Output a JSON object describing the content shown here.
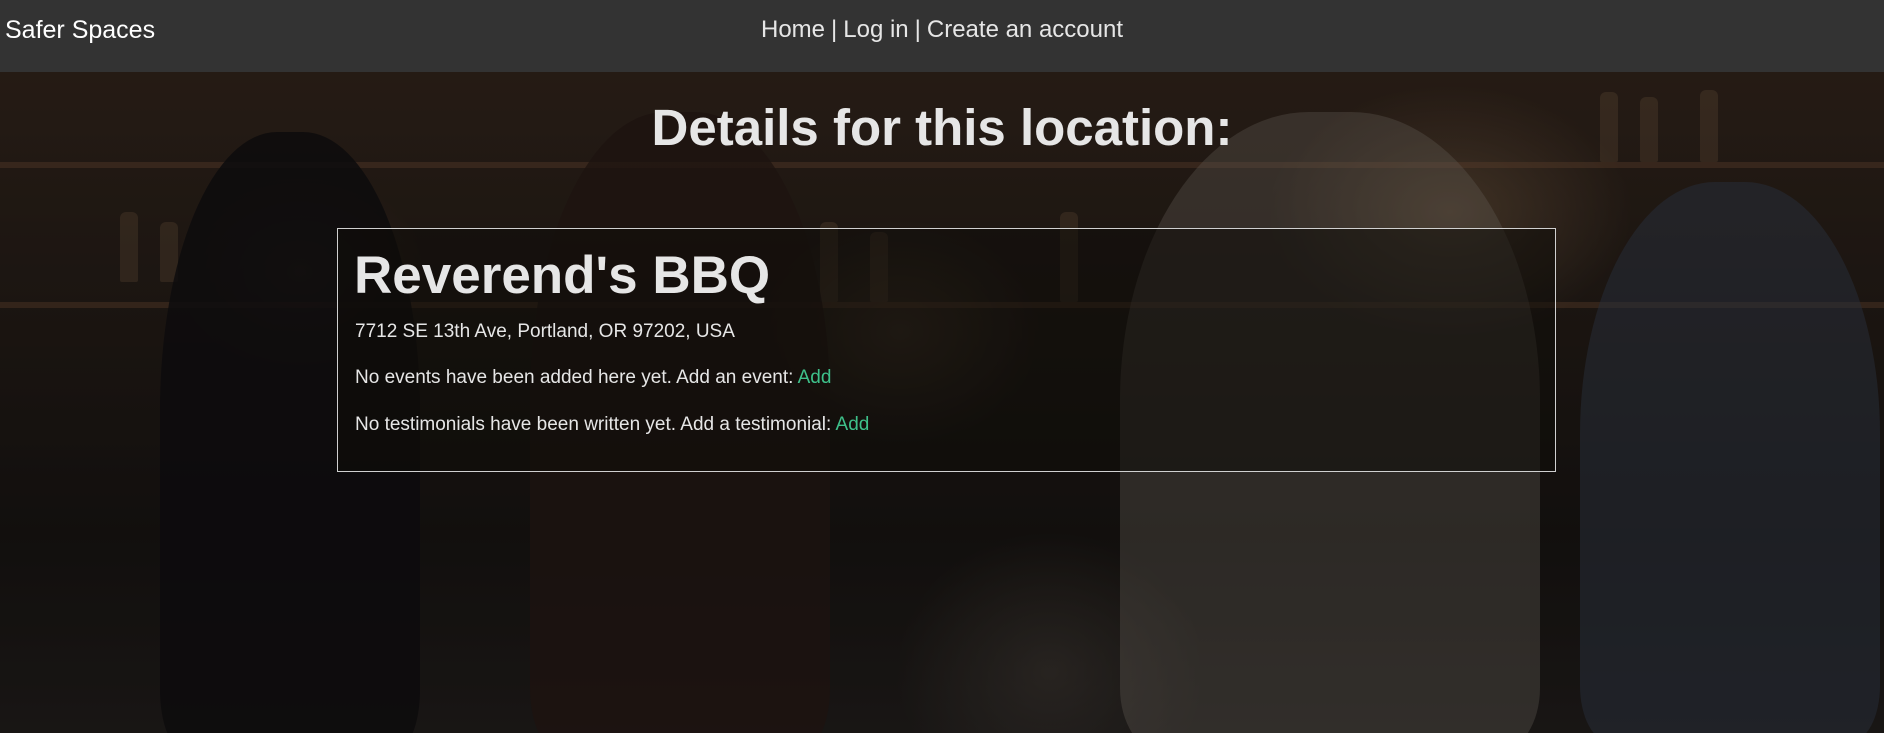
{
  "navbar": {
    "brand": "Safer Spaces",
    "links": {
      "home": "Home",
      "login": "Log in",
      "create_account": "Create an account"
    },
    "separator": "|"
  },
  "main": {
    "title": "Details for this location:",
    "location": {
      "name": "Reverend's BBQ",
      "address": "7712 SE 13th Ave, Portland, OR 97202, USA",
      "events_text": "No events have been added here yet. Add an event:",
      "events_link": "Add",
      "testimonials_text": "No testimonials have been written yet. Add a testimonial:",
      "testimonials_link": "Add"
    }
  },
  "colors": {
    "navbar_bg": "#333333",
    "link_accent": "#3ec08a",
    "text": "#e6e6e6"
  }
}
